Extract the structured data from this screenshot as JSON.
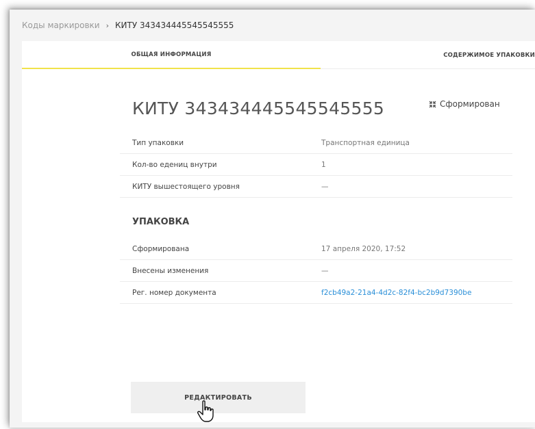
{
  "breadcrumb": {
    "parent": "Коды маркировки",
    "separator": "›",
    "current": "КИТУ 343434445545545555"
  },
  "tabs": [
    {
      "label": "ОБЩАЯ ИНФОРМАЦИЯ",
      "active": true
    },
    {
      "label": "СОДЕРЖИМОЕ УПАКОВКИ",
      "active": false
    }
  ],
  "accent_color": "#f1e24a",
  "link_color": "#2a8fd8",
  "title": "КИТУ 343434445545545555",
  "status": {
    "icon": "formed-status-icon",
    "label": "Сформирован"
  },
  "info_rows": [
    {
      "label": "Тип упаковки",
      "value": "Транспортная единица"
    },
    {
      "label": "Кол-во едениц внутри",
      "value": "1"
    },
    {
      "label": "КИТУ вышестоящего уровня",
      "value": "—"
    }
  ],
  "package_section": {
    "title": "УПАКОВКА",
    "rows": [
      {
        "label": "Сформирована",
        "value": "17 апреля 2020, 17:52"
      },
      {
        "label": "Внесены изменения",
        "value": "—"
      },
      {
        "label": "Рег. номер документа",
        "value": "f2cb49a2-21a4-4d2c-82f4-bc2b9d7390be"
      }
    ]
  },
  "actions": {
    "edit_label": "РЕДАКТИРОВАТЬ"
  },
  "cursor": "hand-pointer-icon"
}
